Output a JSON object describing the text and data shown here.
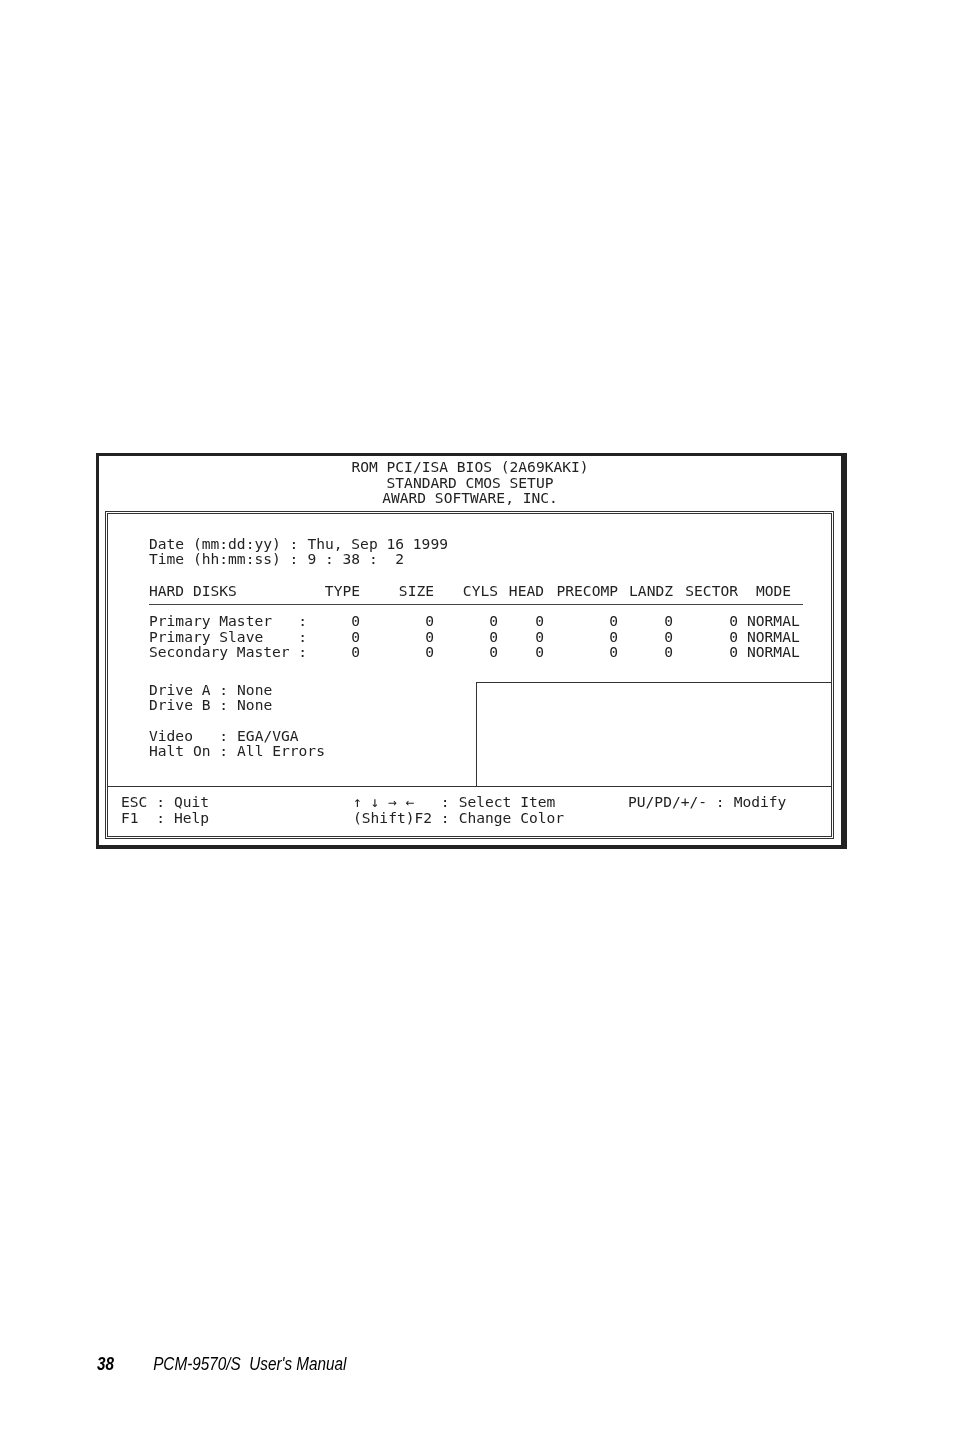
{
  "bios_screen": {
    "header_lines": [
      "ROM PCI/ISA BIOS (2A69KAKI)",
      "STANDARD CMOS SETUP",
      "AWARD SOFTWARE, INC."
    ],
    "datetime": [
      {
        "label": "Date (mm:dd:yy) :",
        "value": "Thu, Sep 16 1999"
      },
      {
        "label": "Time (hh:mm:ss) :",
        "value": "9 : 38 :  2"
      }
    ],
    "hard_disks": {
      "columns": [
        "HARD DISKS",
        "TYPE",
        "SIZE",
        "CYLS",
        "HEAD",
        "PRECOMP",
        "LANDZ",
        "SECTOR",
        "MODE"
      ],
      "rows": [
        {
          "cells": [
            "Primary Master   :",
            "0",
            "0",
            "0",
            "0",
            "0",
            "0",
            "0",
            "NORMAL"
          ]
        },
        {
          "cells": [
            "Primary Slave    :",
            "0",
            "0",
            "0",
            "0",
            "0",
            "0",
            "0",
            "NORMAL"
          ]
        },
        {
          "cells": [
            "Secondary Master :",
            "0",
            "0",
            "0",
            "0",
            "0",
            "0",
            "0",
            "NORMAL"
          ]
        }
      ]
    },
    "drives": [
      {
        "label": "Drive A :",
        "value": "None"
      },
      {
        "label": "Drive B :",
        "value": "None"
      }
    ],
    "settings": [
      {
        "label": "Video   :",
        "value": "EGA/VGA"
      },
      {
        "label": "Halt On :",
        "value": "All Errors"
      }
    ],
    "help_columns": [
      [
        {
          "key": "ESC :",
          "action": "Quit"
        },
        {
          "key": "F1  :",
          "action": "Help"
        }
      ],
      [
        {
          "key": "↑ ↓ → ←   :",
          "action": "Select Item"
        },
        {
          "key": "(Shift)F2 :",
          "action": "Change Color"
        }
      ],
      [
        {
          "key": "PU/PD/+/- :",
          "action": "Modify"
        }
      ]
    ]
  },
  "page_footer": {
    "page_number": "38",
    "title": "PCM-9570/S  User's Manual"
  }
}
